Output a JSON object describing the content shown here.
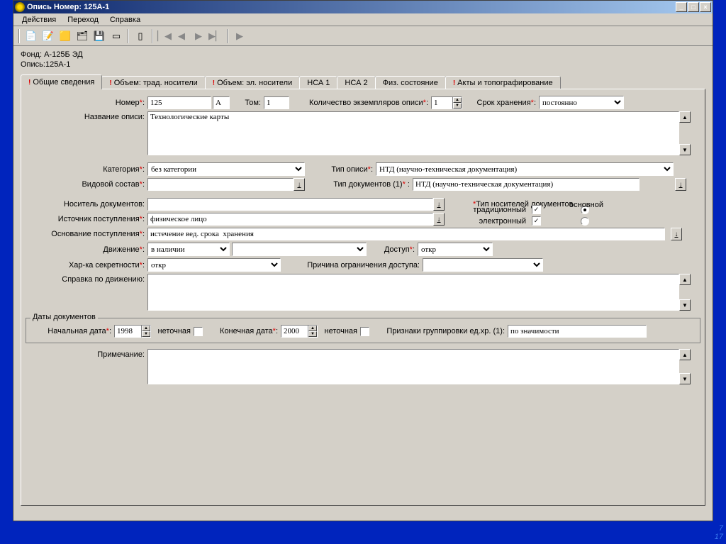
{
  "window": {
    "title": "Опись Номер: 125А-1"
  },
  "menu": {
    "actions": "Действия",
    "goto": "Переход",
    "help": "Справка"
  },
  "header": {
    "fund_label": "Фонд:",
    "fund_value": "А-125Б   ЭД",
    "opis_label": "Опись:",
    "opis_value": "125А-1"
  },
  "tabs": {
    "t1": "Общие сведения",
    "t2": "Объем: трад. носители",
    "t3": "Объем: эл. носители",
    "t4": "НСА 1",
    "t5": "НСА 2",
    "t6": "Физ. состояние",
    "t7": "Акты и топографирование"
  },
  "form": {
    "number_label": "Номер",
    "number_val": "125",
    "number_suffix": "А",
    "tom_label": "Том:",
    "tom_val": "1",
    "copies_label": "Количество экземпляров описи",
    "copies_val": "1",
    "storage_label": "Срок хранения",
    "storage_val": "постоянно",
    "name_label": "Название описи:",
    "name_val": "Технологические карты",
    "category_label": "Категория",
    "category_val": "без категории",
    "opis_type_label": "Тип описи",
    "opis_type_val": "НТД (научно-техническая документация)",
    "species_label": "Видовой состав",
    "doc_type_label": "Тип документов (1)",
    "doc_type_val": "НТД (научно-техническая документация)",
    "carrier_doc_label": "Носитель документов:",
    "carrier_type_label": "Тип носителей документов",
    "main_label": "основной",
    "traditional_label": "традиционный",
    "electronic_label": "электронный",
    "source_label": "Источник поступления",
    "source_val": "физическое лицо",
    "basis_label": "Основание поступления",
    "basis_val": "истечение вед. срока  хранения",
    "movement_label": "Движение",
    "movement_val": "в наличии",
    "access_label": "Доступ",
    "access_val": "откр",
    "secrecy_label": "Хар-ка секретности",
    "secrecy_val": "откр",
    "restrict_reason_label": "Причина ограничения доступа:",
    "movement_ref_label": "Справка по движению:",
    "dates_fieldset": "Даты документов",
    "start_date_label": "Начальная дата",
    "start_date_val": "1998",
    "end_date_label": "Конечная дата",
    "end_date_val": "2000",
    "inexact_label": "неточная",
    "grouping_label": "Признаки группировки ед.хр. (1):",
    "grouping_val": "по значимости",
    "note_label": "Примечание:"
  },
  "corner": {
    "n1": "7",
    "n2": "17"
  }
}
